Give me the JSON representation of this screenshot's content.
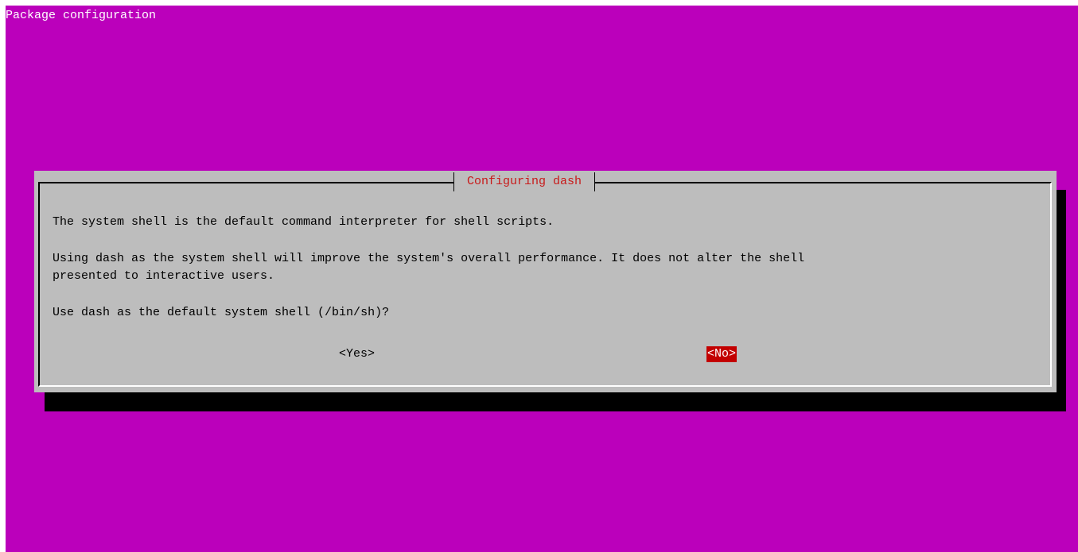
{
  "backtitle": "Package configuration",
  "dialog": {
    "title": "Configuring dash",
    "lines": [
      "The system shell is the default command interpreter for shell scripts.",
      "Using dash as the system shell will improve the system's overall performance. It does not alter the shell",
      "presented to interactive users.",
      "Use dash as the default system shell (/bin/sh)?"
    ],
    "buttons": {
      "yes": "<Yes>",
      "no": "<No>"
    },
    "selected_button": "no"
  },
  "colors": {
    "background": "#bb00bb",
    "dialog": "#bdbdbd",
    "title_text": "#c81a1a",
    "selected_button_bg": "#c30000",
    "shadow": "#000000"
  }
}
